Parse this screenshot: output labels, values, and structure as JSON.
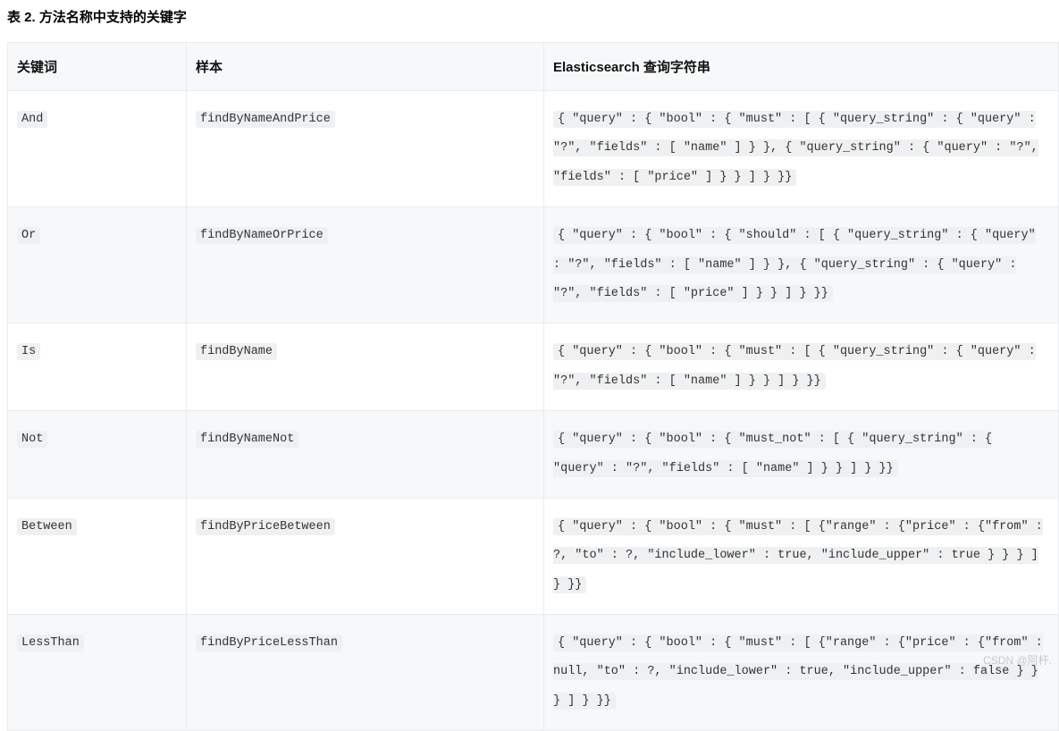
{
  "title": "表 2. 方法名称中支持的关键字",
  "headers": {
    "col1": "关键词",
    "col2": "样本",
    "col3": "Elasticsearch 查询字符串"
  },
  "rows": [
    {
      "keyword": "And",
      "sample": "findByNameAndPrice",
      "query": "{ \"query\" : { \"bool\" : { \"must\" : [ { \"query_string\" : { \"query\" : \"?\", \"fields\" : [ \"name\" ] } }, { \"query_string\" : { \"query\" : \"?\", \"fields\" : [ \"price\" ] } } ] } }}"
    },
    {
      "keyword": "Or",
      "sample": "findByNameOrPrice",
      "query": "{ \"query\" : { \"bool\" : { \"should\" : [ { \"query_string\" : { \"query\" : \"?\", \"fields\" : [ \"name\" ] } }, { \"query_string\" : { \"query\" : \"?\", \"fields\" : [ \"price\" ] } } ] } }}"
    },
    {
      "keyword": "Is",
      "sample": "findByName",
      "query": "{ \"query\" : { \"bool\" : { \"must\" : [ { \"query_string\" : { \"query\" : \"?\", \"fields\" : [ \"name\" ] } } ] } }}"
    },
    {
      "keyword": "Not",
      "sample": "findByNameNot",
      "query": "{ \"query\" : { \"bool\" : { \"must_not\" : [ { \"query_string\" : { \"query\" : \"?\", \"fields\" : [ \"name\" ] } } ] } }}"
    },
    {
      "keyword": "Between",
      "sample": "findByPriceBetween",
      "query": "{ \"query\" : { \"bool\" : { \"must\" : [ {\"range\" : {\"price\" : {\"from\" : ?, \"to\" : ?, \"include_lower\" : true, \"include_upper\" : true } } } ] } }}"
    },
    {
      "keyword": "LessThan",
      "sample": "findByPriceLessThan",
      "query": "{ \"query\" : { \"bool\" : { \"must\" : [ {\"range\" : {\"price\" : {\"from\" : null, \"to\" : ?, \"include_lower\" : true, \"include_upper\" : false } } } ] } }}"
    }
  ],
  "watermark": "CSDN @阿杆."
}
